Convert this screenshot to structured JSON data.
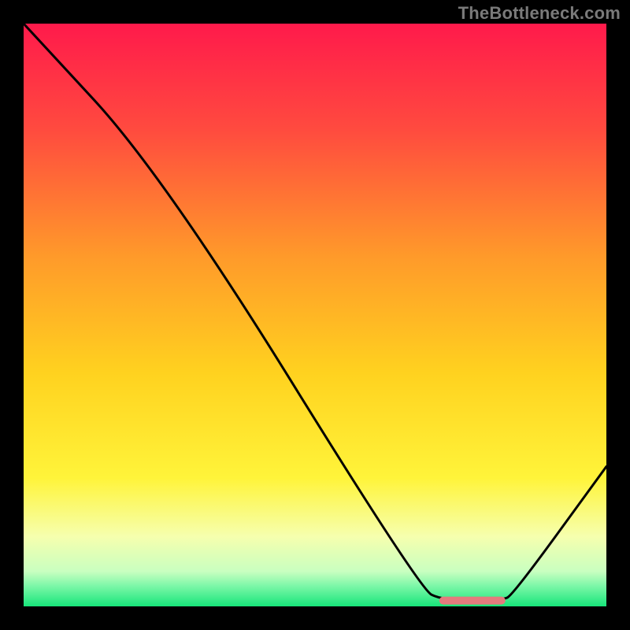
{
  "watermark": "TheBottleneck.com",
  "chart_data": {
    "type": "line",
    "title": "",
    "xlabel": "",
    "ylabel": "",
    "xlim": [
      0,
      100
    ],
    "ylim": [
      0,
      100
    ],
    "grid": false,
    "legend": false,
    "curve": {
      "name": "bottleneck-curve",
      "x": [
        0,
        24,
        68,
        72,
        82,
        84,
        100
      ],
      "y": [
        100,
        74,
        3,
        1,
        1,
        2,
        24
      ]
    },
    "highlight_segment": {
      "name": "optimal-range-marker",
      "color": "#e47a7d",
      "x": [
        72,
        82
      ],
      "y": [
        1,
        1
      ]
    },
    "background_gradient": {
      "type": "vertical",
      "stops": [
        {
          "pos": 0.0,
          "color": "#ff1a4b"
        },
        {
          "pos": 0.18,
          "color": "#ff4a3f"
        },
        {
          "pos": 0.4,
          "color": "#ff9a2a"
        },
        {
          "pos": 0.6,
          "color": "#ffd21f"
        },
        {
          "pos": 0.78,
          "color": "#fff43a"
        },
        {
          "pos": 0.88,
          "color": "#f6ffae"
        },
        {
          "pos": 0.94,
          "color": "#c9ffc0"
        },
        {
          "pos": 0.965,
          "color": "#7cf7a8"
        },
        {
          "pos": 1.0,
          "color": "#17e57a"
        }
      ]
    }
  }
}
